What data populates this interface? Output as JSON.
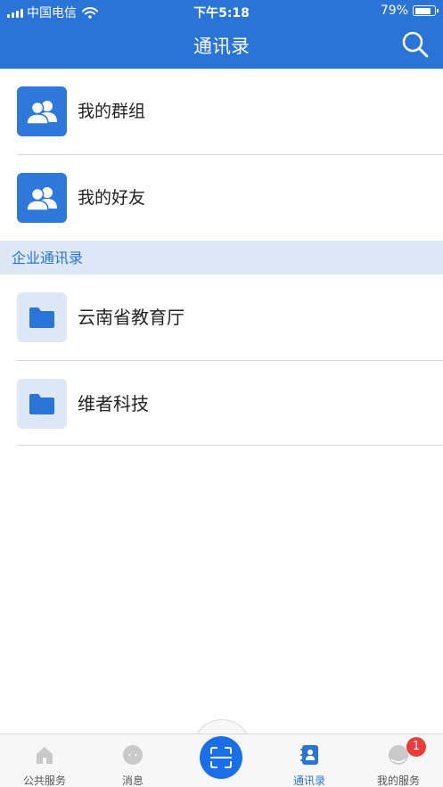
{
  "status_bar": {
    "carrier": "中国电信",
    "time": "下午5:18",
    "battery": "79%",
    "battery_level": 0.79
  },
  "header": {
    "title": "通讯录",
    "search_icon": "search-icon"
  },
  "list": [
    {
      "label": "我的群组",
      "icon": "group-icon"
    },
    {
      "label": "我的好友",
      "icon": "friends-icon"
    }
  ],
  "section": {
    "title": "企业通讯录"
  },
  "org_list": [
    {
      "label": "云南省教育厅",
      "icon": "folder-icon"
    },
    {
      "label": "维者科技",
      "icon": "folder-icon"
    }
  ],
  "tabbar": {
    "tabs": [
      {
        "label": "公共服务",
        "icon": "home-icon"
      },
      {
        "label": "消息",
        "icon": "message-icon"
      },
      {
        "label": "通讯录",
        "icon": "contacts-icon",
        "active": true
      },
      {
        "label": "我的服务",
        "icon": "profile-icon"
      }
    ],
    "scan_icon": "scan-icon",
    "badge": "1"
  },
  "colors": {
    "primary": "#2a74d8",
    "section_bg": "#dde8f7",
    "badge": "#ec3b3b"
  }
}
